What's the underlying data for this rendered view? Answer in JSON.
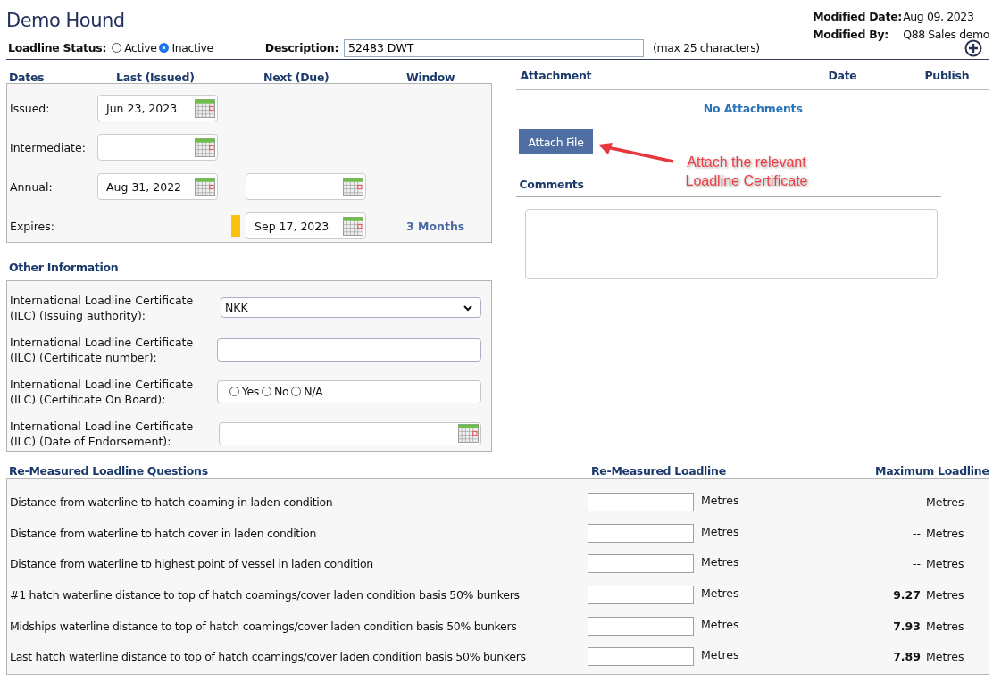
{
  "title": "Demo Hound",
  "modified": [
    {
      "label": "Modified Date:",
      "value": "Aug 09, 2023"
    },
    {
      "label": "Modified By:",
      "value": "Q88 Sales demo"
    }
  ],
  "status": {
    "label": "Loadline Status:",
    "options": [
      {
        "label": "Active",
        "selected": false
      },
      {
        "label": "Inactive",
        "selected": true
      }
    ]
  },
  "description": {
    "label": "Description:",
    "value": "52483 DWT",
    "hint": "(max 25 characters)"
  },
  "dates": {
    "columns": [
      "Dates",
      "Last (Issued)",
      "Next (Due)",
      "Window"
    ],
    "rows": [
      {
        "label": "Issued:",
        "last": {
          "kind": "date",
          "value": "Jun 23, 2023"
        }
      },
      {
        "label": "Intermediate:",
        "last": {
          "kind": "date"
        }
      },
      {
        "label": "Annual:",
        "last": {
          "kind": "date",
          "value": "Aug 31, 2022"
        },
        "next": {
          "kind": "date"
        }
      },
      {
        "label": "Expires:",
        "color": "#fcc10f",
        "next": {
          "kind": "date",
          "value": "Sep 17, 2023"
        },
        "window": "3 Months"
      }
    ]
  },
  "other": {
    "title": "Other Information",
    "items": [
      {
        "kind": "select",
        "label": "International Loadline Certificate (ILC) (Issuing authority):",
        "value": "NKK"
      },
      {
        "kind": "text",
        "label": "International Loadline Certificate (ILC) (Certificate number):"
      },
      {
        "kind": "radio",
        "label": "International Loadline Certificate (ILC) (Certificate On Board):",
        "options": [
          {
            "label": "Yes",
            "selected": false
          },
          {
            "label": "No",
            "selected": false
          },
          {
            "label": "N/A",
            "selected": false
          }
        ]
      },
      {
        "kind": "date",
        "label": "International Loadline Certificate (ILC) (Date of Endorsement):"
      }
    ]
  },
  "attachments": {
    "columns": [
      "Attachment",
      "Date",
      "Publish"
    ],
    "empty": "No Attachments",
    "button": "Attach File",
    "annotation": "Attach the relevant Loadline Certificate"
  },
  "comments": {
    "title": "Comments"
  },
  "questions": {
    "columns": [
      "Re-Measured Loadline Questions",
      "Re-Measured Loadline",
      "Maximum Loadline"
    ],
    "rows": [
      {
        "question": "Distance from waterline to hatch coaming in laden condition",
        "unit": "Metres",
        "max": "--",
        "max_bold": false,
        "max_unit": "Metres"
      },
      {
        "question": "Distance from waterline to hatch cover in laden condition",
        "unit": "Metres",
        "max": "--",
        "max_bold": false,
        "max_unit": "Metres"
      },
      {
        "question": "Distance from waterline to highest point of vessel in laden condition",
        "unit": "Metres",
        "max": "--",
        "max_bold": false,
        "max_unit": "Metres"
      },
      {
        "question": "#1 hatch waterline distance to top of hatch coamings/cover laden condition basis 50% bunkers",
        "unit": "Metres",
        "max": "9.27",
        "max_bold": true,
        "max_unit": "Metres"
      },
      {
        "question": "Midships waterline distance to top of hatch coamings/cover laden condition basis 50% bunkers",
        "unit": "Metres",
        "max": "7.93",
        "max_bold": true,
        "max_unit": "Metres"
      },
      {
        "question": "Last hatch waterline distance to top of hatch coamings/cover laden condition basis 50% bunkers",
        "unit": "Metres",
        "max": "7.89",
        "max_bold": true,
        "max_unit": "Metres"
      }
    ]
  }
}
